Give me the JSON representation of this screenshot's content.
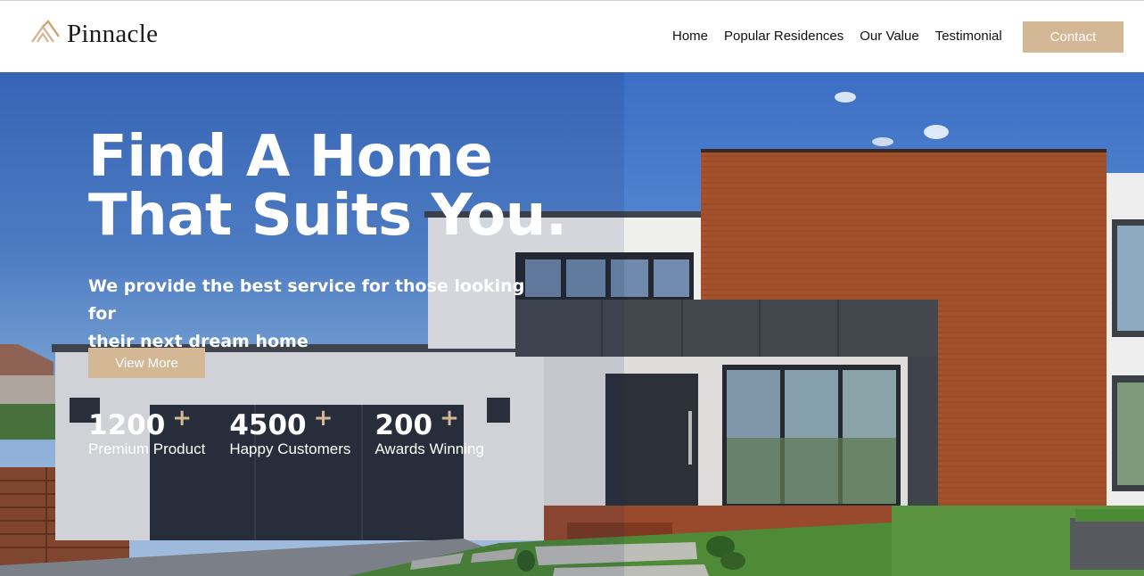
{
  "brand": {
    "name": "Pinnacle",
    "logo_icon": "chevron-roof-logo-icon",
    "accent": "#d4b795"
  },
  "nav": {
    "items": [
      {
        "label": "Home"
      },
      {
        "label": "Popular Residences"
      },
      {
        "label": "Our Value"
      },
      {
        "label": "Testimonial"
      }
    ],
    "contact_label": "Contact"
  },
  "hero": {
    "title_line1": "Find A Home",
    "title_line2": "That Suits You.",
    "subtitle_line1": "We provide the best service for those looking for",
    "subtitle_line2": "their next dream home",
    "cta_label": "View More",
    "stats": [
      {
        "value": "1200",
        "plus": "+",
        "label": "Premium Product"
      },
      {
        "value": "4500",
        "plus": "+",
        "label": "Happy Customers"
      },
      {
        "value": "200",
        "plus": "+",
        "label": "Awards Winning"
      }
    ]
  }
}
